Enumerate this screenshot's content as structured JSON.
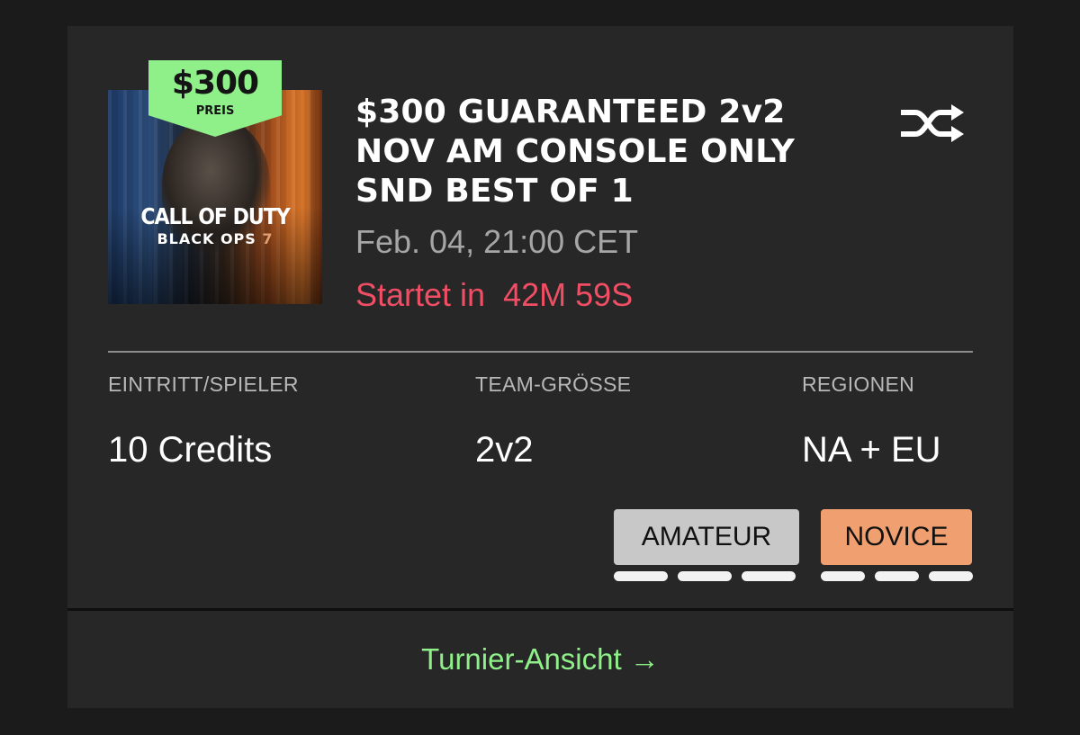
{
  "tournament": {
    "prize_amount": "$300",
    "prize_label": "PREIS",
    "game_logo_line1": "CALL OF DUTY",
    "game_logo_line2": "BLACK OPS",
    "game_logo_number": "7",
    "title": "$300 GUARANTEED 2v2 NOV AM CONSOLE ONLY SND BEST OF 1",
    "date": "Feb. 04, 21:00 CET",
    "countdown_prefix": "Startet in",
    "countdown_value": "42M 59S"
  },
  "stats": {
    "entry_label": "EINTRITT/SPIELER",
    "entry_value": "10 Credits",
    "team_label": "TEAM-GRÖSSE",
    "team_value": "2v2",
    "regions_label": "REGIONEN",
    "regions_value": "NA + EU"
  },
  "skill_badges": [
    {
      "label": "AMATEUR",
      "color": "#c8c8c8"
    },
    {
      "label": "NOVICE",
      "color": "#f0a070"
    }
  ],
  "footer": {
    "link_label": "Turnier-Ansicht",
    "link_icon": "arrow-right-icon"
  },
  "colors": {
    "accent_green": "#8ff08a",
    "countdown_red": "#f04e64",
    "card_bg": "#272727",
    "page_bg": "#1b1b1b"
  },
  "icons": {
    "mode": "shuffle-icon"
  }
}
